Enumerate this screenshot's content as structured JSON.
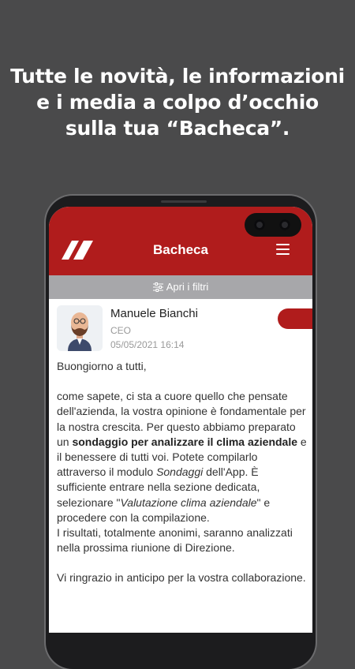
{
  "headline": {
    "line1": "Tutte le novità, le informazioni",
    "line2": "e i media a colpo d’occhio",
    "line3": "sulla tua “Bacheca”."
  },
  "app": {
    "title": "Bacheca",
    "brand_color": "#b01c1c",
    "icons": {
      "logo": "brand-logo",
      "menu": "hamburger-menu-icon",
      "filter": "sliders-icon"
    }
  },
  "filter": {
    "label": "Apri i filtri"
  },
  "post": {
    "author": "Manuele Bianchi",
    "role": "CEO",
    "date": "05/05/2021 16:14",
    "greeting": "Buongiorno a tutti,",
    "p1_a": "come sapete, ci sta a cuore quello che pensate dell'azienda, la vostra opinione è fondamentale per la nostra crescita. Per questo abbiamo preparato un ",
    "p1_bold": "sondaggio per analizzare il clima aziendale",
    "p1_b": " e il benessere di tutti voi. Potete compilarlo attraverso il modulo ",
    "p1_italic1": "Sondaggi",
    "p1_c": " dell'App. È sufficiente entrare nella sezione dedicata, selezionare  \"",
    "p1_italic2": "Valutazione clima aziendale",
    "p1_d": "\" e procedere con la compilazione.",
    "p2": "I risultati, totalmente anonimi, saranno analizzati nella prossima riunione di Direzione.",
    "p3": "Vi ringrazio in anticipo per la vostra collaborazione."
  }
}
